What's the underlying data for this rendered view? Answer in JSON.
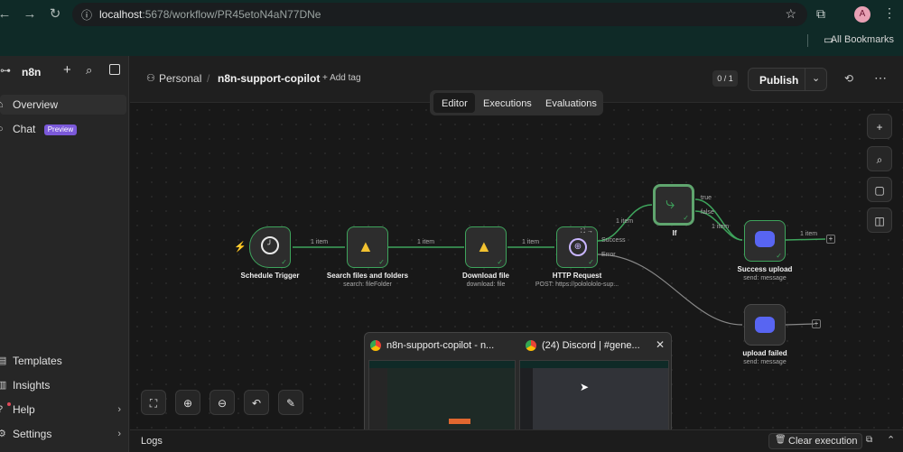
{
  "browser": {
    "url_host": "localhost",
    "url_path": ":5678/workflow/PR45etoN4aN77DNe",
    "bookmarks_label": "All Bookmarks",
    "avatar_letter": "A"
  },
  "sidebar": {
    "brand": "n8n",
    "items": [
      {
        "label": "Overview"
      },
      {
        "label": "Chat",
        "badge": "Preview"
      },
      {
        "label": "Templates"
      },
      {
        "label": "Insights"
      },
      {
        "label": "Help"
      },
      {
        "label": "Settings"
      }
    ]
  },
  "header": {
    "project": "Personal",
    "workflow_name": "n8n-support-copilot",
    "add_tag": "+ Add tag",
    "counter": "0 / 1",
    "publish": "Publish"
  },
  "tabs": [
    "Editor",
    "Executions",
    "Evaluations"
  ],
  "nodes": [
    {
      "label": "Schedule Trigger",
      "sub": ""
    },
    {
      "label": "Search files and folders",
      "sub": "search: fileFolder"
    },
    {
      "label": "Download file",
      "sub": "download: file"
    },
    {
      "label": "HTTP Request",
      "sub": "POST: https://pololololo-sup..."
    },
    {
      "label": "If",
      "sub": ""
    },
    {
      "label": "Success upload",
      "sub": "send: message"
    },
    {
      "label": "upload failed",
      "sub": "send: message"
    }
  ],
  "edges": {
    "item": "1 item",
    "success": "Success",
    "error": "Error",
    "true": "true",
    "false": "false"
  },
  "preview": {
    "tab1": "n8n-support-copilot - n...",
    "tab2": "(24) Discord | #gene..."
  },
  "logs": {
    "label": "Logs",
    "clear": "Clear execution"
  },
  "colors": {
    "accent": "#3ea45c",
    "discord": "#5865f2",
    "badge": "#7b59d9"
  }
}
